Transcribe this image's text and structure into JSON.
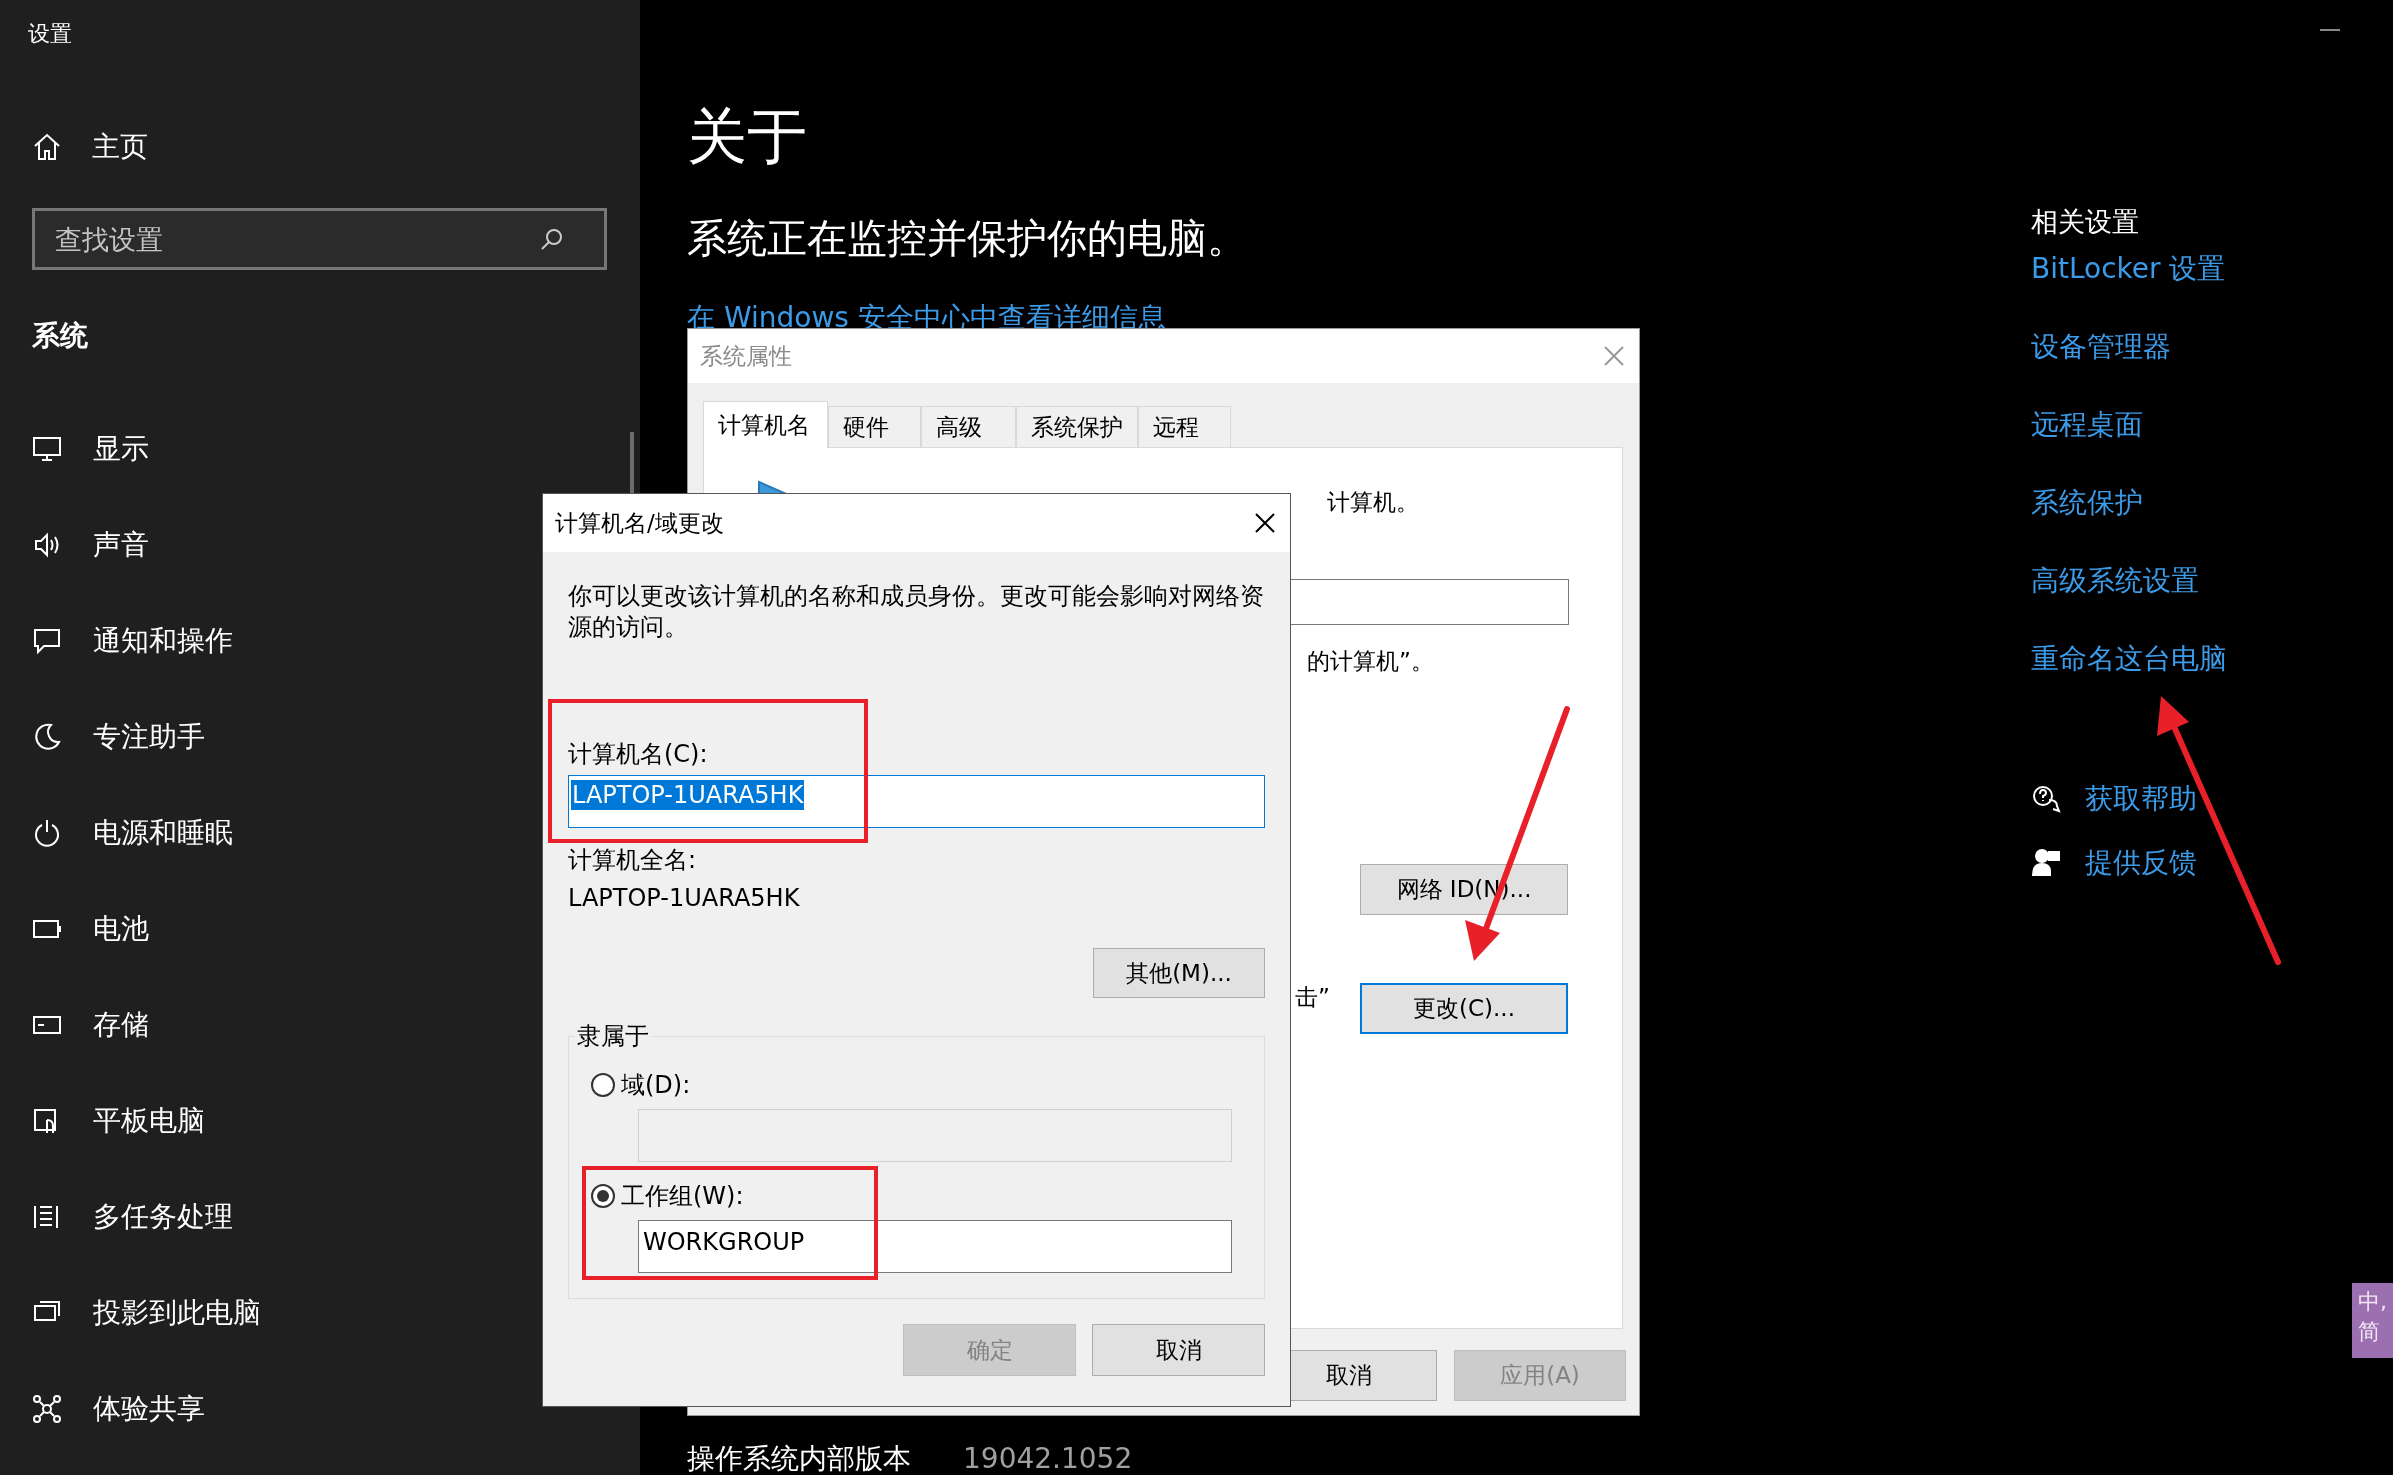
{
  "settings": {
    "title": "设置",
    "home": "主页",
    "search": {
      "placeholder": "查找设置"
    },
    "section": "系统",
    "nav_items": [
      {
        "label": "显示"
      },
      {
        "label": "声音"
      },
      {
        "label": "通知和操作"
      },
      {
        "label": "专注助手"
      },
      {
        "label": "电源和睡眠"
      },
      {
        "label": "电池"
      },
      {
        "label": "存储"
      },
      {
        "label": "平板电脑"
      },
      {
        "label": "多任务处理"
      },
      {
        "label": "投影到此电脑"
      },
      {
        "label": "体验共享"
      }
    ]
  },
  "about": {
    "heading": "关于",
    "status": "系统正在监控并保护你的电脑。",
    "security_link": "在 Windows 安全中心中查看详细信息",
    "details": [
      {
        "label": "操作系统内部版本",
        "value": "19042.1052"
      }
    ]
  },
  "related_settings": {
    "title": "相关设置",
    "links": [
      "BitLocker 设置",
      "设备管理器",
      "远程桌面",
      "系统保护",
      "高级系统设置",
      "重命名这台电脑"
    ]
  },
  "help_links": [
    "获取帮助",
    "提供反馈"
  ],
  "system_properties": {
    "title": "系统属性",
    "tabs": [
      {
        "label": "计算机名",
        "selected": true
      },
      {
        "label": "硬件",
        "selected": false
      },
      {
        "label": "高级",
        "selected": false
      },
      {
        "label": "系统保护",
        "selected": false
      },
      {
        "label": "远程",
        "selected": false
      }
    ],
    "text_fragments": [
      "计算机。",
      "的计算机”。",
      "击”"
    ],
    "buttons": [
      {
        "label": "网络 ID(N)...",
        "focused": false
      },
      {
        "label": "更改(C)...",
        "focused": true
      }
    ],
    "footer_buttons": [
      {
        "label": "取消",
        "disabled": false
      },
      {
        "label": "应用(A)",
        "disabled": true
      }
    ]
  },
  "rename_dialog": {
    "title": "计算机名/域更改",
    "description": "你可以更改该计算机的名称和成员身份。更改可能会影响对网络资源的访问。",
    "computer_name": {
      "label": "计算机名(C):",
      "value": "LAPTOP-1UARA5HK",
      "text_selected": true
    },
    "full_name": {
      "label": "计算机全名:",
      "value": "LAPTOP-1UARA5HK"
    },
    "more_button": "其他(M)...",
    "member_of": {
      "title": "隶属于",
      "options": [
        {
          "label": "域(D):",
          "selected": false
        },
        {
          "label": "工作组(W):",
          "selected": true,
          "value": "WORKGROUP"
        }
      ]
    },
    "buttons": [
      {
        "label": "确定",
        "disabled": true
      },
      {
        "label": "取消",
        "disabled": false
      }
    ]
  },
  "ime_indicator": {
    "mode": "中,",
    "layout": "简"
  }
}
